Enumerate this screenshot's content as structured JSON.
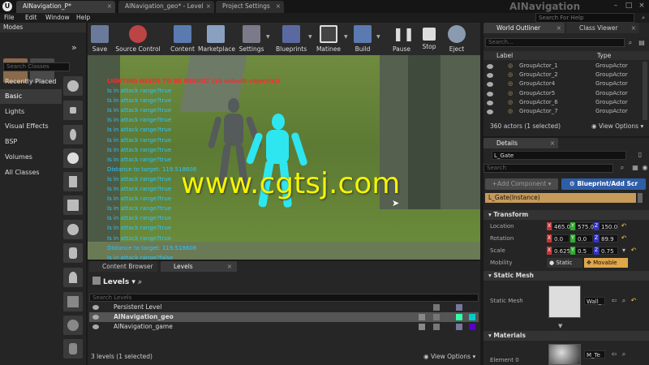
{
  "titlebar": {
    "tabs": [
      {
        "label": "AINavigation_P*"
      },
      {
        "label": "AINavigation_geo* - Level"
      },
      {
        "label": "Project Settings"
      }
    ],
    "app_name": "AINavigation",
    "search_help_placeholder": "Search For Help"
  },
  "menu": [
    "File",
    "Edit",
    "Window",
    "Help"
  ],
  "modes": {
    "title": "Modes",
    "search_placeholder": "Search Classes",
    "categories": [
      "Recently Placed",
      "Basic",
      "Lights",
      "Visual Effects",
      "BSP",
      "Volumes",
      "All Classes"
    ]
  },
  "toolbar": [
    "Save",
    "Source Control",
    "Content",
    "Marketplace",
    "Settings",
    "Blueprints",
    "Matinee",
    "Build",
    "Pause",
    "Stop",
    "Eject"
  ],
  "viewport": {
    "warning": "LIGHTING NEEDS TO BE REBUILT (10 unbuilt object(s))",
    "debug_lines": [
      "Is in attack range?true",
      "Is in attack range?true",
      "Is in attack range?true",
      "Is in attack range?true",
      "Is in attack range?true",
      "Is in attack range?true",
      "Is in attack range?true",
      "Is in attack range?true",
      "Distance to target: 119.518608",
      "Is in attack range?true",
      "Is in attack range?true",
      "Is in attack range?true",
      "Is in attack range?true",
      "Is in attack range?true",
      "Is in attack range?true",
      "Is in attack range?true",
      "Distance to target: 119.518608",
      "Is in attack range?false"
    ],
    "watermark": "www.cgtsj.com"
  },
  "bottom": {
    "tabs": [
      "Content Browser",
      "Levels"
    ],
    "levels_label": "Levels",
    "search_placeholder": "Search Levels",
    "levels": [
      "Persistent Level",
      "AINavigation_geo",
      "AINavigation_game"
    ],
    "status": "3 levels (1 selected)",
    "view_options": "View Options"
  },
  "outliner": {
    "tabs": [
      "World Outliner",
      "Class Viewer"
    ],
    "search_placeholder": "Search...",
    "col_label": "Label",
    "col_type": "Type",
    "rows": [
      {
        "label": "GroupActor_1",
        "type": "GroupActor"
      },
      {
        "label": "GroupActor_2",
        "type": "GroupActor"
      },
      {
        "label": "GroupActor4",
        "type": "GroupActor"
      },
      {
        "label": "GroupActor5",
        "type": "GroupActor"
      },
      {
        "label": "GroupActor_6",
        "type": "GroupActor"
      },
      {
        "label": "GroupActor_7",
        "type": "GroupActor"
      }
    ],
    "status": "360 actors (1 selected)",
    "view_options": "View Options"
  },
  "details": {
    "tab": "Details",
    "name": "L_Gate",
    "search_placeholder": "Search",
    "add_component": "+Add Component",
    "blueprint_button": "Blueprint/Add Scr",
    "instance": "L_Gate(Instance)",
    "transform_title": "Transform",
    "location_label": "Location",
    "location": [
      "465.0",
      "575.0",
      "150.0"
    ],
    "rotation_label": "Rotation",
    "rotation": [
      "0.0",
      "0.0",
      "89.9"
    ],
    "scale_label": "Scale",
    "scale": [
      "0.625",
      "0.5",
      "0.75"
    ],
    "mobility_label": "Mobility",
    "mobility_static": "Static",
    "mobility_movable": "Movable",
    "static_mesh_title": "Static Mesh",
    "static_mesh_label": "Static Mesh",
    "static_mesh_value": "Wall_",
    "materials_title": "Materials",
    "element_label": "Element 0",
    "element_value": "M_Te"
  }
}
